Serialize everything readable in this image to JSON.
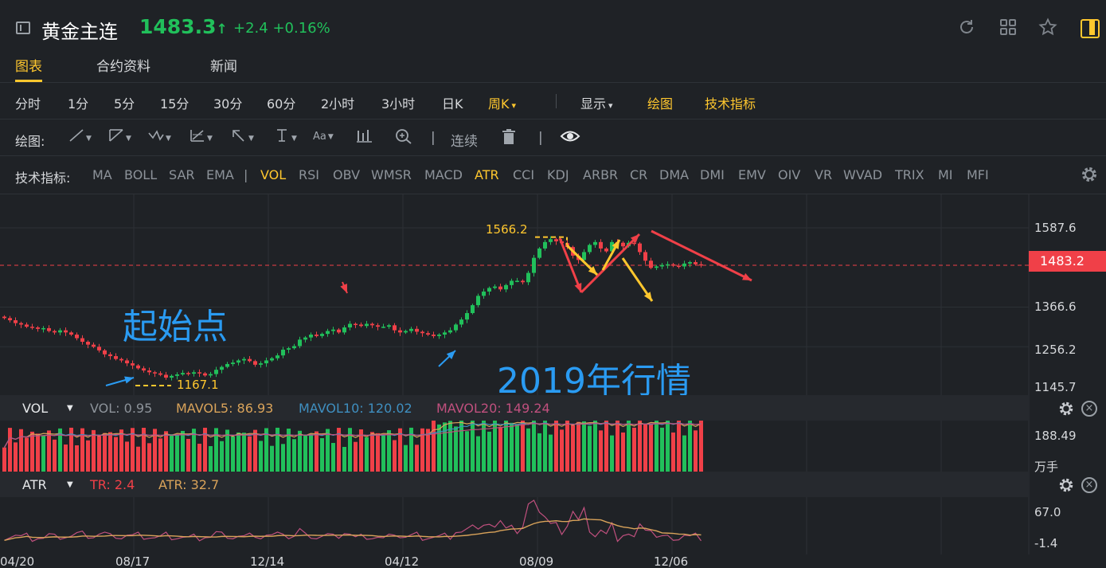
{
  "header": {
    "symbol_name": "黄金主连",
    "price": "1483.3",
    "price_arrow": "↑",
    "change": "+2.4",
    "change_pct": "+0.16%",
    "icons": [
      "refresh-icon",
      "grid-icon",
      "star-icon",
      "panel-toggle-icon"
    ],
    "colors": {
      "up": "#21c05b",
      "accent": "#ffc72e",
      "down": "#f04048"
    }
  },
  "tabs": [
    {
      "label": "图表",
      "active": true
    },
    {
      "label": "合约资料",
      "active": false
    },
    {
      "label": "新闻",
      "active": false
    }
  ],
  "periods": [
    "分时",
    "1分",
    "5分",
    "15分",
    "30分",
    "60分",
    "2小时",
    "3小时",
    "日K",
    "周K"
  ],
  "period_selected": "周K",
  "period_caret": "▾",
  "toolbar_right": {
    "display": "显示",
    "draw": "绘图",
    "tech": "技术指标"
  },
  "drawbar": {
    "label": "绘图:",
    "tools": [
      "line-tool-icon",
      "channel-tool-icon",
      "wave-tool-icon",
      "fib-tool-icon",
      "arrow-tool-icon",
      "text-tool-icon",
      "font-tool-icon",
      "bars-tool-icon",
      "zoom-tool-icon"
    ],
    "continuous": "连续",
    "font_glyph": "Aa"
  },
  "indicators": {
    "label": "技术指标:",
    "items": [
      "MA",
      "BOLL",
      "SAR",
      "EMA",
      "VOL",
      "RSI",
      "OBV",
      "WMSR",
      "MACD",
      "ATR",
      "CCI",
      "KDJ",
      "ARBR",
      "CR",
      "DMA",
      "DMI",
      "EMV",
      "OIV",
      "VR",
      "WVAD",
      "TRIX",
      "MI",
      "MFI"
    ],
    "active": [
      "VOL",
      "ATR"
    ],
    "separator": "|"
  },
  "price_axis": [
    "1587.6",
    "1366.6",
    "1256.2",
    "1145.7"
  ],
  "last_price_tag": "1483.2",
  "marks": {
    "high": "1566.2",
    "low": "1167.1"
  },
  "annotations": {
    "start": "起始点",
    "year": "2019年行情"
  },
  "vol_pane": {
    "name": "VOL",
    "vol": "VOL: 0.95",
    "mavol5": "MAVOL5: 86.93",
    "mavol10": "MAVOL10: 120.02",
    "mavol20": "MAVOL20: 149.24",
    "axis_top": "188.49",
    "axis_unit": "万手",
    "colors": {
      "mavol5": "#d9a35a",
      "mavol10": "#3f8fc0",
      "mavol20": "#c0507e"
    }
  },
  "atr_pane": {
    "name": "ATR",
    "tr": "TR: 2.4",
    "atr": "ATR: 32.7",
    "axis_top": "67.0",
    "axis_bottom": "-1.4"
  },
  "dates": [
    "04/20",
    "08/17",
    "12/14",
    "04/12",
    "08/09",
    "12/06"
  ],
  "chart_data": {
    "type": "candlestick",
    "y_axis_ticks": [
      1587.6,
      1366.6,
      1256.2,
      1145.7
    ],
    "last_price": 1483.2,
    "high_mark": 1566.2,
    "low_mark": 1167.1,
    "x_tick_labels": [
      "04/20",
      "08/17",
      "12/14",
      "04/12",
      "08/09",
      "12/06"
    ],
    "closes": [
      1336,
      1330,
      1322,
      1318,
      1312,
      1310,
      1306,
      1308,
      1300,
      1296,
      1302,
      1296,
      1290,
      1280,
      1270,
      1262,
      1256,
      1246,
      1235,
      1230,
      1222,
      1218,
      1210,
      1204,
      1196,
      1190,
      1185,
      1182,
      1178,
      1170,
      1175,
      1179,
      1183,
      1181,
      1185,
      1182,
      1176,
      1180,
      1192,
      1200,
      1208,
      1212,
      1218,
      1222,
      1216,
      1206,
      1210,
      1218,
      1224,
      1232,
      1248,
      1252,
      1258,
      1276,
      1282,
      1290,
      1286,
      1292,
      1300,
      1304,
      1296,
      1310,
      1320,
      1318,
      1314,
      1320,
      1316,
      1312,
      1312,
      1316,
      1302,
      1296,
      1300,
      1306,
      1298,
      1294,
      1290,
      1286,
      1290,
      1296,
      1302,
      1318,
      1332,
      1350,
      1372,
      1398,
      1410,
      1420,
      1424,
      1416,
      1428,
      1440,
      1440,
      1436,
      1462,
      1504,
      1530,
      1548,
      1556,
      1550,
      1545,
      1534,
      1510,
      1498,
      1520,
      1540,
      1548,
      1530,
      1522,
      1548,
      1546,
      1536,
      1546,
      1544,
      1520,
      1496,
      1476,
      1480,
      1484,
      1486,
      1482,
      1480,
      1488,
      1492,
      1486,
      1483
    ],
    "volume_pane": {
      "mavol5": 86.93,
      "mavol10": 120.02,
      "mavol20": 149.24,
      "vol": 0.95,
      "ylim_top": 188.49
    },
    "atr_pane": {
      "tr": 2.4,
      "atr": 32.7,
      "ylim": [
        -1.4,
        67.0
      ]
    }
  }
}
